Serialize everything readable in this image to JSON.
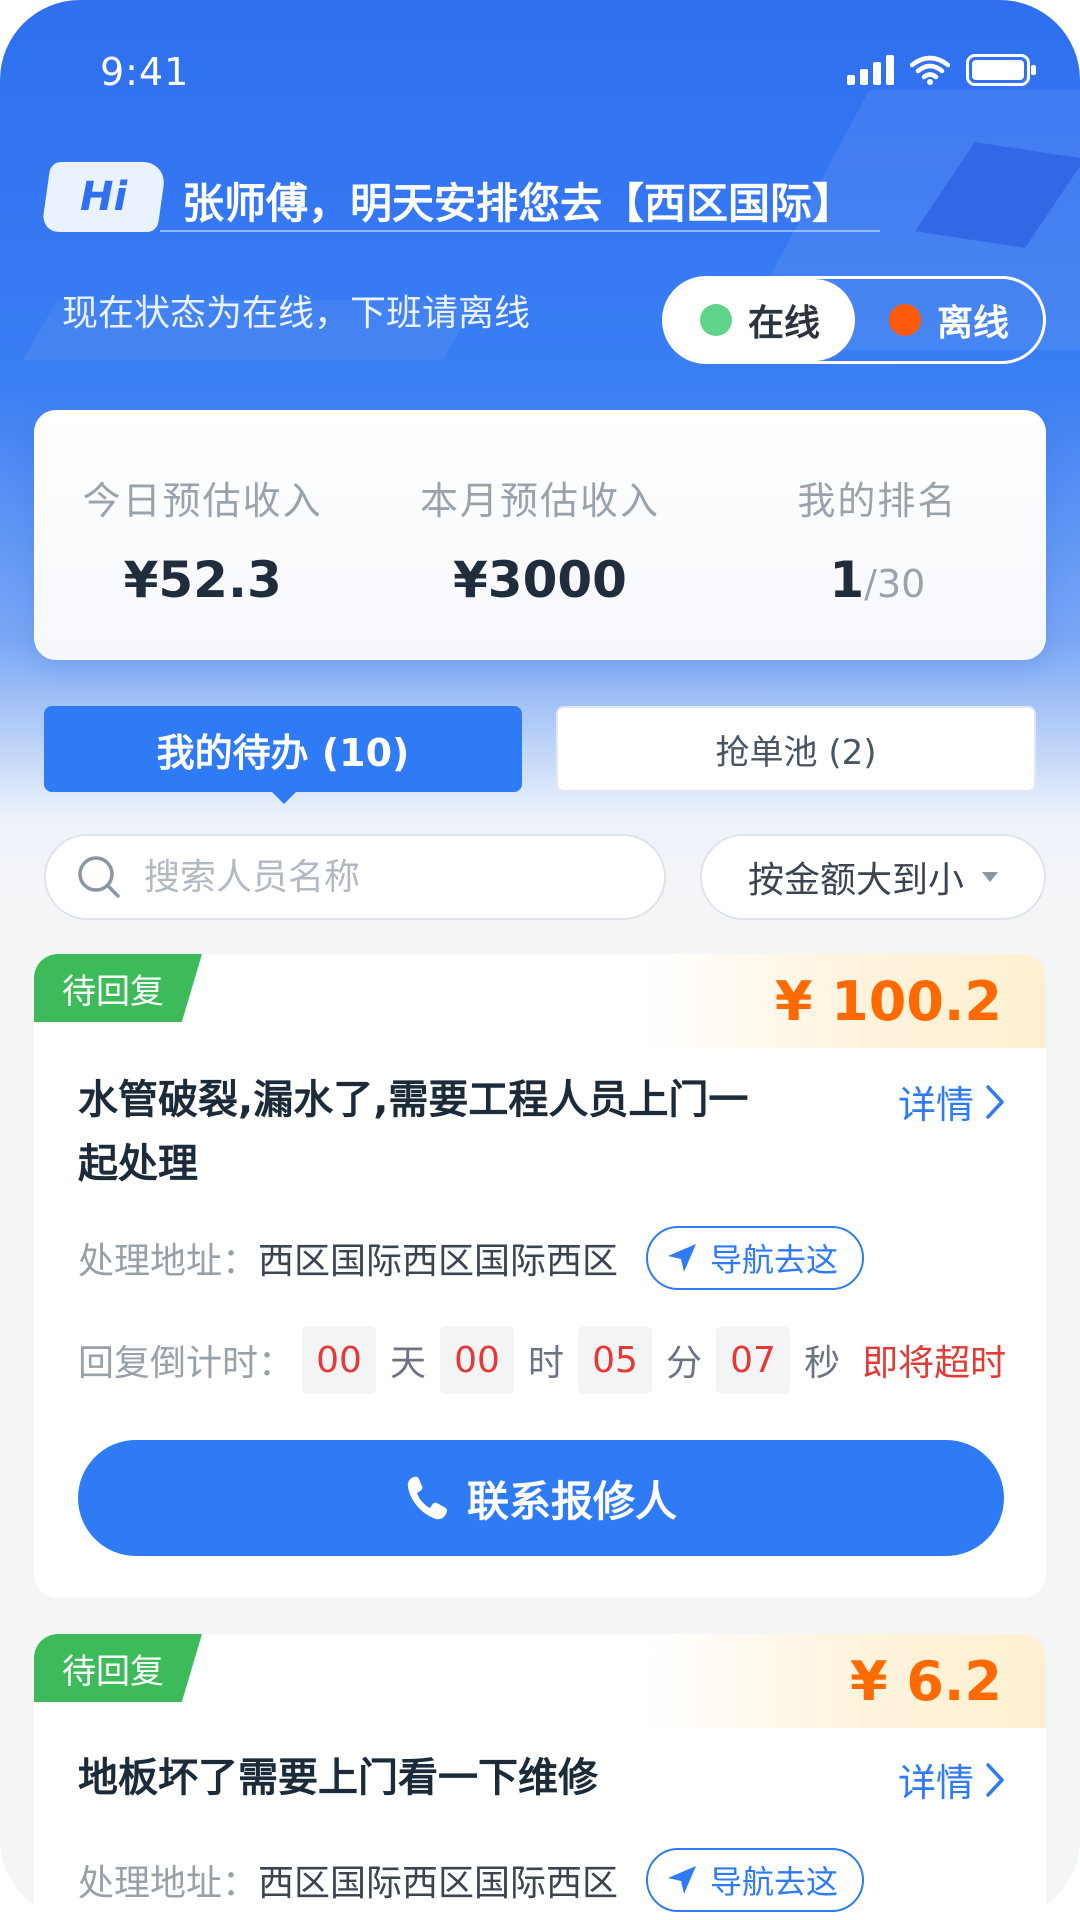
{
  "status_bar": {
    "time": "9:41"
  },
  "header": {
    "hi_badge": "Hi",
    "greeting": "张师傅，明天安排您去【西区国际】",
    "status_text": "现在状态为在线，下班请离线",
    "toggle": {
      "online_label": "在线",
      "offline_label": "离线",
      "selected": "在线"
    }
  },
  "stats": [
    {
      "label": "今日预估收入",
      "value": "¥52.3"
    },
    {
      "label": "本月预估收入",
      "value": "¥3000"
    },
    {
      "label": "我的排名",
      "rank": "1",
      "total": "/30"
    }
  ],
  "tabs": {
    "active": "我的待办 (10)",
    "inactive": "抢单池 (2)"
  },
  "search": {
    "placeholder": "搜索人员名称",
    "value": ""
  },
  "sort": {
    "label": "按金额大到小"
  },
  "orders": [
    {
      "tag": "待回复",
      "price": "¥ 100.2",
      "title_line1": "水管破裂,漏水了,需要工程人员上门一",
      "title_line2": "起处理",
      "detail": "详情",
      "address_label": "处理地址：",
      "address": "西区国际西区国际西区",
      "navigate": "导航去这",
      "countdown_label": "回复倒计时：",
      "countdown": {
        "days": "00",
        "hours": "00",
        "minutes": "05",
        "seconds": "07"
      },
      "units": {
        "day": "天",
        "hour": "时",
        "minute": "分",
        "second": "秒"
      },
      "warning": "即将超时",
      "contact": "联系报修人"
    },
    {
      "tag": "待回复",
      "price": "¥ 6.2",
      "title_line1": "地板坏了需要上门看一下维修",
      "detail": "详情",
      "address_label": "处理地址：",
      "address": "西区国际西区国际西区",
      "navigate": "导航去这"
    }
  ],
  "colors": {
    "primary": "#2f7af5",
    "online_dot": "#5fd48a",
    "offline_dot": "#ff5a0a",
    "tag_green": "#3dbb5a",
    "price_orange": "#ff6a00",
    "warning_red": "#e53935"
  }
}
